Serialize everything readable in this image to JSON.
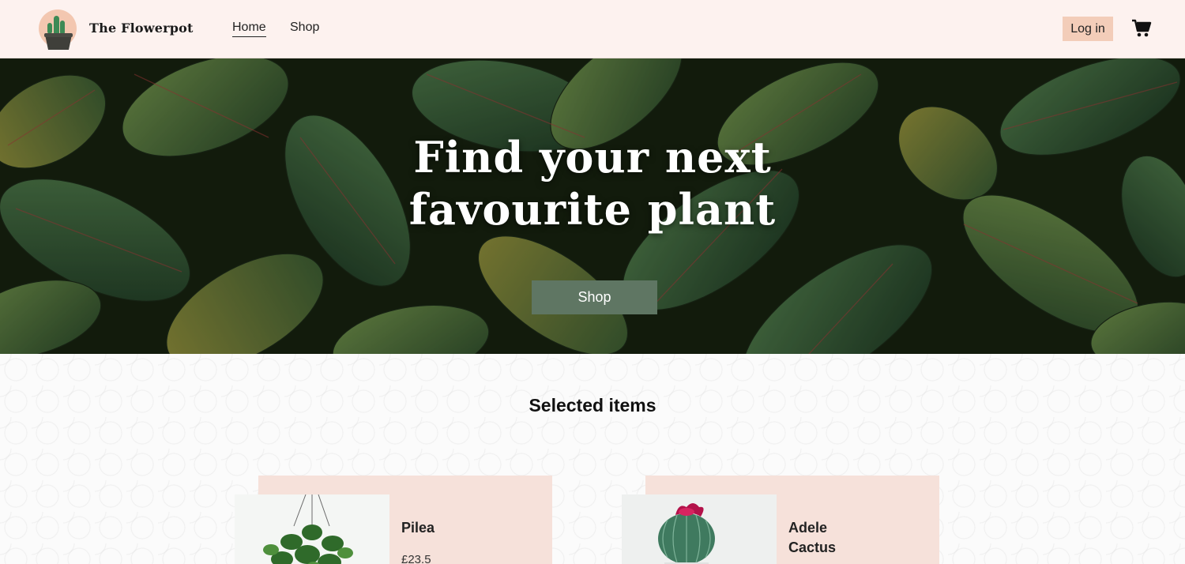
{
  "header": {
    "brand": "The Flowerpot",
    "nav": [
      {
        "label": "Home",
        "active": true
      },
      {
        "label": "Shop",
        "active": false
      }
    ],
    "login_label": "Log in",
    "cart_icon": "shopping-cart-icon",
    "logo_icon": "cactus-logo-icon"
  },
  "hero": {
    "title_line1": "Find your next",
    "title_line2": "favourite plant",
    "button_label": "Shop"
  },
  "main": {
    "section_title": "Selected items",
    "products": [
      {
        "name": "Pilea",
        "price": "£23.5"
      },
      {
        "name_line1": "Adele",
        "name_line2": "Cactus"
      }
    ]
  },
  "colors": {
    "header_bg": "#fdf2ef",
    "login_bg": "#f3cdb9",
    "hero_button": "#5f7663",
    "card_bg": "#f6e1da"
  }
}
